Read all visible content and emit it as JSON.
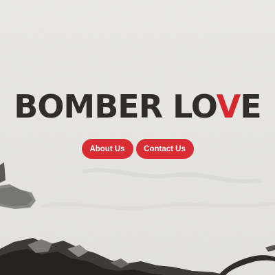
{
  "logo": {
    "text_before": "BOMBER LO",
    "accent_letter": "V",
    "text_after": "E"
  },
  "nav": {
    "about_label": "About Us",
    "contact_label": "Contact Us"
  },
  "colors": {
    "accent": "#d92c33",
    "logo_dark": "#2f2e2b",
    "background": "#ecebe8"
  }
}
